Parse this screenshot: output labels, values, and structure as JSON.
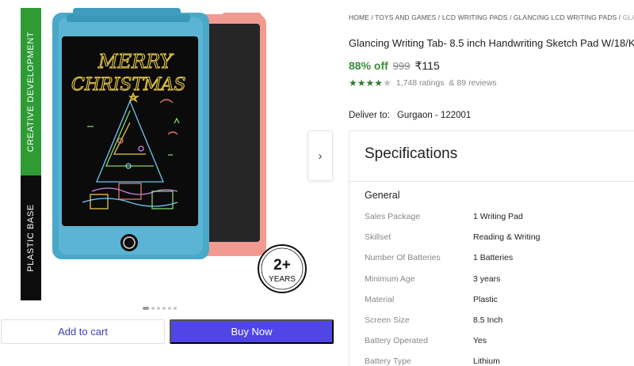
{
  "gallery": {
    "band_top_text": "CREATIVE DEVELOPMENT",
    "band_bottom_text": "PLASTIC BASE",
    "screen_line1": "MERRY",
    "screen_line2": "CHRISTMAS",
    "age_badge_number": "2+",
    "age_badge_unit": "YEARS",
    "next_icon": "chevron-right-icon",
    "slide_count": 6,
    "active_slide": 1
  },
  "actions": {
    "add_to_cart": "Add to cart",
    "buy_now": "Buy Now"
  },
  "breadcrumb": {
    "items": [
      "HOME",
      "TOYS AND GAMES",
      "LCD WRITING PADS",
      "GLANCING LCD WRITING PADS",
      "GLANCING WR"
    ],
    "separator": " / "
  },
  "product": {
    "title": "Glancing Writing Tab- 8.5 inch Handwriting Sketch Pad W/18/K",
    "discount": "88% off",
    "mrp": "999",
    "price": "₹115",
    "rating_value": 4,
    "ratings_text": "1,748 ratings",
    "reviews_text": "& 89 reviews"
  },
  "delivery": {
    "label": "Deliver to:",
    "location": "Gurgaon - 122001"
  },
  "specs": {
    "heading": "Specifications",
    "section": "General",
    "rows": [
      {
        "label": "Sales Package",
        "value": "1 Writing Pad"
      },
      {
        "label": "Skillset",
        "value": "Reading & Writing"
      },
      {
        "label": "Number Of Batteries",
        "value": "1 Batteries"
      },
      {
        "label": "Minimum Age",
        "value": "3 years"
      },
      {
        "label": "Material",
        "value": "Plastic"
      },
      {
        "label": "Screen Size",
        "value": "8.5 Inch"
      },
      {
        "label": "Battery Operated",
        "value": "Yes"
      },
      {
        "label": "Battery Type",
        "value": "Lithium"
      }
    ]
  },
  "colors": {
    "accent": "#4f46e5",
    "discount_green": "#388e3c",
    "band_green": "#2e9b35",
    "pad_blue": "#4aa8c9",
    "pad_pink": "#f29a90"
  }
}
